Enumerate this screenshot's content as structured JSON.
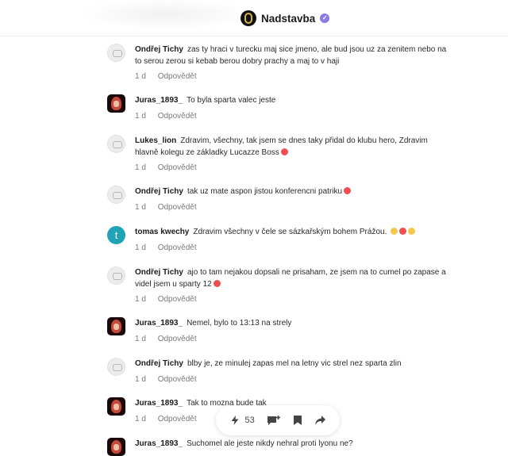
{
  "header": {
    "brand_name": "Nadstavba",
    "verified_icon": "verified-badge-icon",
    "logo_icon": "nadstavba-logo-icon"
  },
  "comments": [
    {
      "author": "Ondřej Tichy",
      "avatar": "default-avatar-icon",
      "text": "zas ty hraci v turecku maj sice jmeno, ale bud jsou uz za zenitem nebo na to serou zerou si kebab berou dobry prachy a maj to v haji",
      "age": "1 d",
      "reply": "Odpovědět"
    },
    {
      "author": "Juras_1893_",
      "avatar": "photo-avatar",
      "text": "To byla sparta valec jeste",
      "age": "1 d",
      "reply": "Odpovědět"
    },
    {
      "author": "Lukes_lion",
      "avatar": "default-avatar-icon",
      "text": "Zdravim, všechny, tak jsem se dnes taky přidal do klubu hero, Zdravim hlavně kolegu ze základky Lucazze Boss",
      "emojis": [
        "red"
      ],
      "age": "1 d",
      "reply": "Odpovědět"
    },
    {
      "author": "Ondřej Tichy",
      "avatar": "default-avatar-icon",
      "text": "tak uz mate aspon jistou konferencni patriku",
      "emojis": [
        "red"
      ],
      "age": "1 d",
      "reply": "Odpovědět"
    },
    {
      "author": "tomas kwechy",
      "avatar_letter": "t",
      "text": "Zdravim všechny v čele se sázkařským bohem Prážou.",
      "emojis": [
        "yellow",
        "red",
        "yellow"
      ],
      "age": "1 d",
      "reply": "Odpovědět"
    },
    {
      "author": "Ondřej Tichy",
      "avatar": "default-avatar-icon",
      "text": "ajo to tam nejakou dopsali ne prisaham, ze jsem na to cumel po zapase a videl jsem u sparty 12",
      "emojis": [
        "red"
      ],
      "age": "1 d",
      "reply": "Odpovědět"
    },
    {
      "author": "Juras_1893_",
      "avatar": "photo-avatar",
      "text": "Nemel, bylo to 13:13 na strely",
      "age": "1 d",
      "reply": "Odpovědět"
    },
    {
      "author": "Ondřej Tichy",
      "avatar": "default-avatar-icon",
      "text": "blby je, ze minulej zapas mel na letny vic strel nez sparta zlin",
      "age": "1 d",
      "reply": "Odpovědět"
    },
    {
      "author": "Juras_1893_",
      "avatar": "photo-avatar",
      "text": "Tak to mozna bude tak",
      "age": "1 d",
      "reply": "Odpovědět"
    },
    {
      "author": "Juras_1893_",
      "avatar": "photo-avatar",
      "text": "Suchomel ale jeste nikdy nehral proti lyonu ne?",
      "age": "",
      "reply": ""
    }
  ],
  "actionbar": {
    "likes_count": "53",
    "like_icon": "lightning-like-icon",
    "comment_icon": "add-comment-icon",
    "bookmark_icon": "bookmark-icon",
    "share_icon": "share-arrow-icon"
  }
}
